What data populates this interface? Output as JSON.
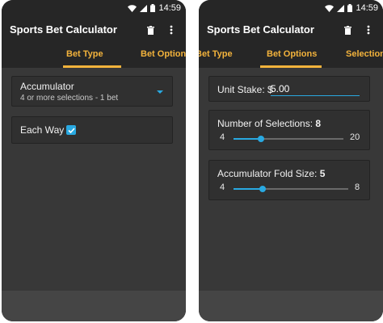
{
  "status": {
    "time": "14:59"
  },
  "app": {
    "title": "Sports Bet Calculator"
  },
  "left_screen": {
    "tabs": [
      {
        "label": "Bet Type",
        "active": true
      },
      {
        "label": "Bet Options",
        "active": false
      }
    ],
    "bet_type": {
      "name": "Accumulator",
      "description": "4 or more selections - 1 bet"
    },
    "each_way": {
      "label": "Each Way",
      "checked": true
    }
  },
  "right_screen": {
    "tabs": [
      {
        "label": "Bet Type",
        "active": false
      },
      {
        "label": "Bet Options",
        "active": true
      },
      {
        "label": "Selections",
        "active": false
      }
    ],
    "unit_stake": {
      "label": "Unit Stake:",
      "currency": "$",
      "value": "5.00"
    },
    "num_selections": {
      "label": "Number of Selections:",
      "value": "8",
      "min": "4",
      "max": "20",
      "fraction": 0.25
    },
    "fold_size": {
      "label": "Accumulator Fold Size:",
      "value": "5",
      "min": "4",
      "max": "8",
      "fraction": 0.25
    }
  },
  "colors": {
    "accent": "#29a9e1",
    "tab_text": "#f3b33c",
    "toolbar": "#262626",
    "background": "#383838"
  },
  "icons": {
    "delete": "trash-icon",
    "menu": "more-vert-icon",
    "wifi": "wifi-icon",
    "signal": "signal-icon",
    "battery": "battery-icon",
    "check": "check-icon"
  }
}
